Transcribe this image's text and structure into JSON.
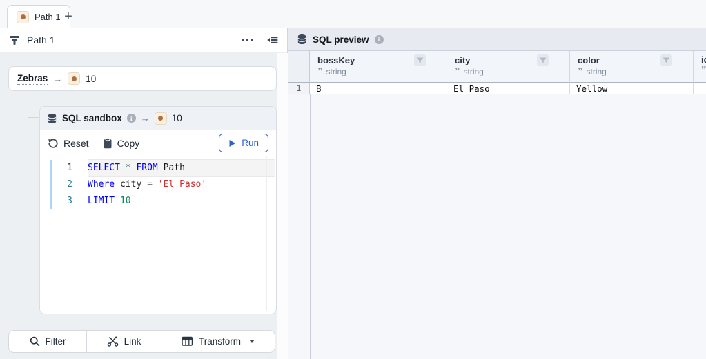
{
  "colors": {
    "accent_blue": "#2c62c9",
    "badge_dot": "#b26d3f",
    "code_keyword": "#0000ff",
    "code_operator": "#417f74",
    "code_string": "#cd3131",
    "code_number": "#098658"
  },
  "tabbar": {
    "active_tab": "Path 1",
    "new_tab_label": "+"
  },
  "panel": {
    "title": "Path 1"
  },
  "zebras": {
    "label": "Zebras",
    "arrow": "→",
    "count": "10"
  },
  "sandbox": {
    "title": "SQL sandbox",
    "arrow": "→",
    "count": "10",
    "reset_label": "Reset",
    "copy_label": "Copy",
    "run_label": "Run"
  },
  "code": {
    "line1": {
      "no": "1",
      "kw1": "SELECT",
      "op": "*",
      "kw2": "FROM",
      "id": "Path"
    },
    "line2": {
      "no": "2",
      "kw": "Where",
      "id": "city",
      "eq": "=",
      "str": "'El Paso'"
    },
    "line3": {
      "no": "3",
      "kw": "LIMIT",
      "num": "10"
    }
  },
  "actions": {
    "filter": "Filter",
    "link": "Link",
    "transform": "Transform"
  },
  "preview": {
    "title": "SQL preview",
    "columns": [
      {
        "name": "bossKey",
        "type": "string"
      },
      {
        "name": "city",
        "type": "string"
      },
      {
        "name": "color",
        "type": "string"
      },
      {
        "name": "id",
        "type": "string"
      }
    ],
    "row": {
      "num": "1",
      "bossKey": "B",
      "city": "El Paso",
      "color": "Yellow",
      "id": ""
    }
  }
}
